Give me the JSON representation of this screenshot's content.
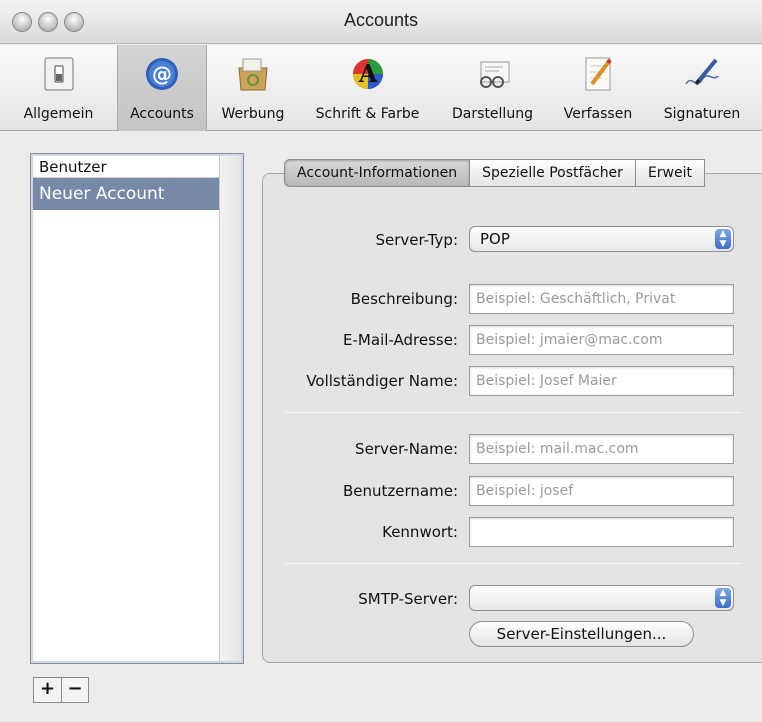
{
  "window": {
    "title": "Accounts"
  },
  "toolbar": {
    "items": [
      {
        "label": "Allgemein",
        "icon": "switch-icon"
      },
      {
        "label": "Accounts",
        "icon": "at-sign-icon",
        "selected": true
      },
      {
        "label": "Werbung",
        "icon": "junk-mail-icon"
      },
      {
        "label": "Schrift & Farbe",
        "icon": "font-color-icon"
      },
      {
        "label": "Darstellung",
        "icon": "glasses-icon"
      },
      {
        "label": "Verfassen",
        "icon": "pencil-paper-icon"
      },
      {
        "label": "Signaturen",
        "icon": "signature-pen-icon"
      }
    ]
  },
  "accounts_list": {
    "header": "Benutzer",
    "items": [
      {
        "label": "Neuer Account",
        "selected": true
      }
    ],
    "add_label": "+",
    "remove_label": "−"
  },
  "tabs": [
    {
      "label": "Account-Informationen",
      "active": true
    },
    {
      "label": "Spezielle Postfächer",
      "active": false
    },
    {
      "label": "Erweit",
      "active": false
    }
  ],
  "form": {
    "server_type": {
      "label": "Server-Typ:",
      "value": "POP"
    },
    "description": {
      "label": "Beschreibung:",
      "placeholder": "Beispiel: Geschäftlich, Privat"
    },
    "email": {
      "label": "E-Mail-Adresse:",
      "placeholder": "Beispiel: jmaier@mac.com"
    },
    "full_name": {
      "label": "Vollständiger Name:",
      "placeholder": "Beispiel: Josef Maier"
    },
    "server_name": {
      "label": "Server-Name:",
      "placeholder": "Beispiel: mail.mac.com"
    },
    "username": {
      "label": "Benutzername:",
      "placeholder": "Beispiel: josef"
    },
    "password": {
      "label": "Kennwort:",
      "value": ""
    },
    "smtp_server": {
      "label": "SMTP-Server:",
      "value": ""
    },
    "server_settings_button": "Server-Einstellungen..."
  },
  "colors": {
    "selection": "#768aa8",
    "popup_arrow": "#3d6fc7"
  }
}
